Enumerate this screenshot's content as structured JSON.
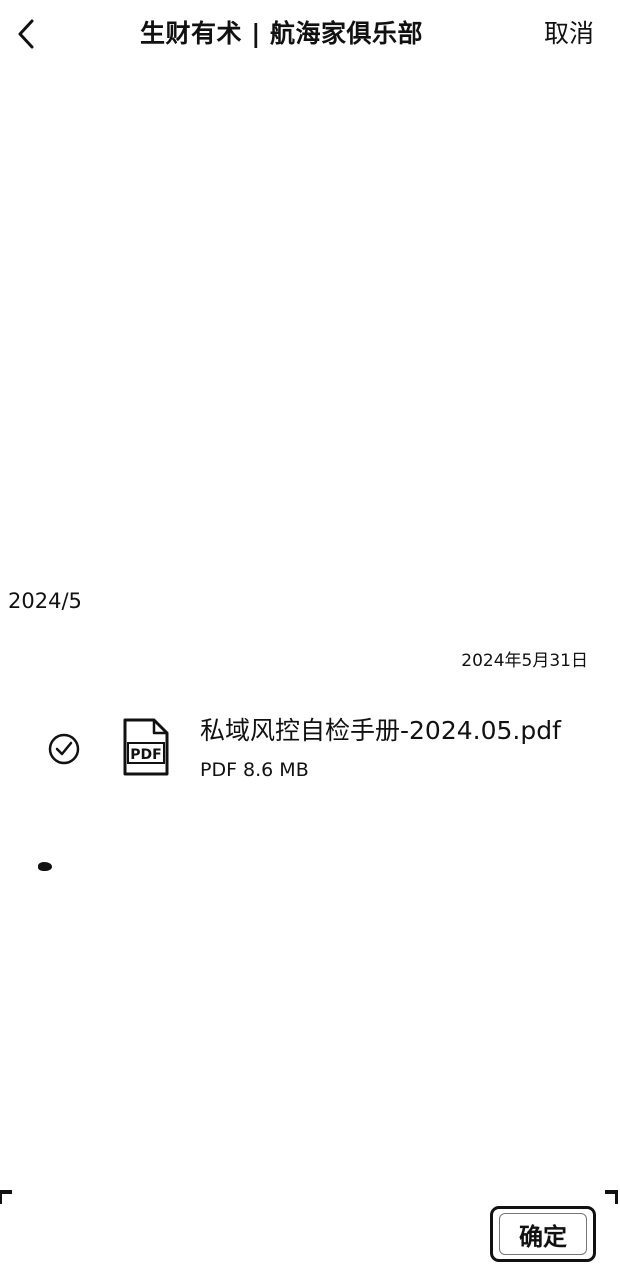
{
  "header": {
    "back_icon": "chevron-left-icon",
    "title": "生财有术 | 航海家俱乐部",
    "cancel_label": "取消"
  },
  "content": {
    "month_label": "2024/5",
    "date_label": "2024年5月31日",
    "file": {
      "name": "私域风控自检手册-2024.05.pdf",
      "meta": "PDF 8.6 MB",
      "icon": "pdf-file-icon",
      "icon_text": "PDF",
      "selected": true
    }
  },
  "footer": {
    "confirm_label": "确定"
  }
}
